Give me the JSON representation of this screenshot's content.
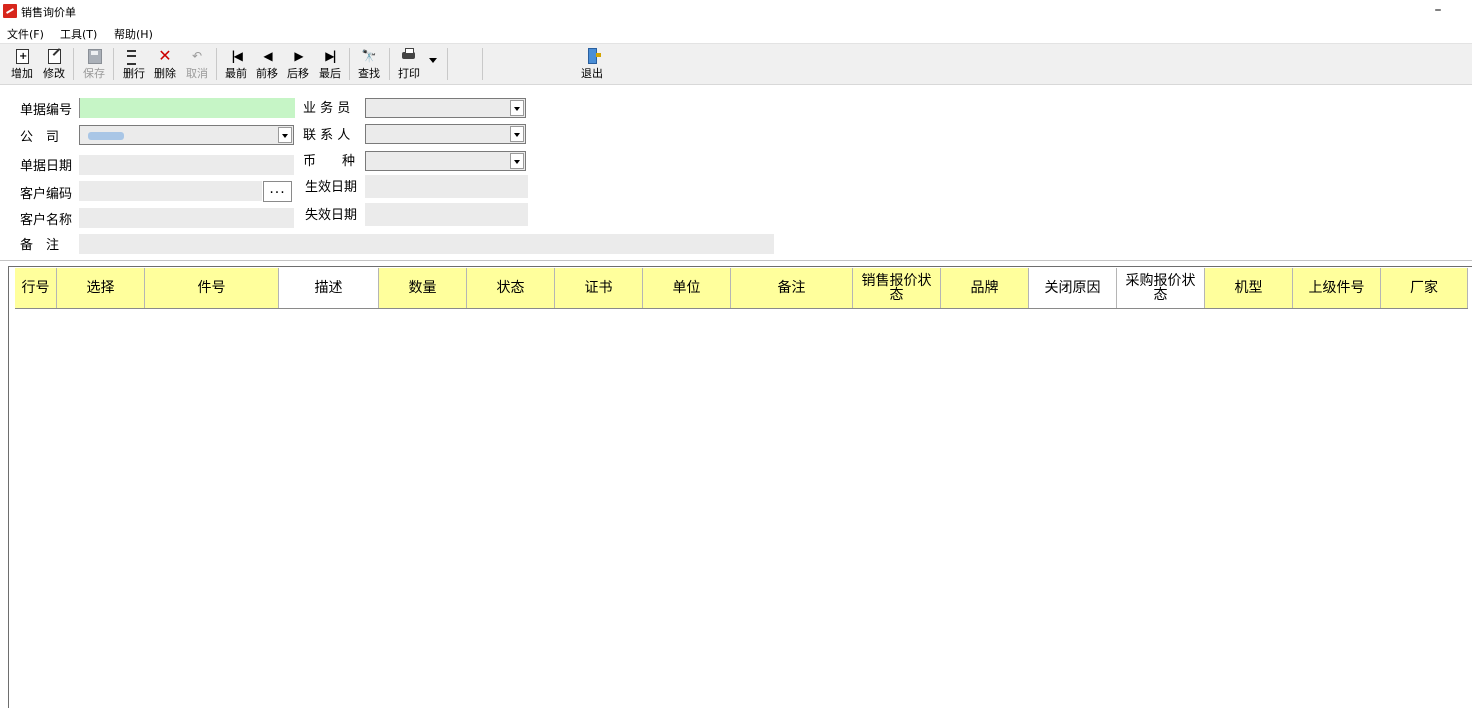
{
  "window": {
    "title": "销售询价单",
    "minimize_glyph": "–"
  },
  "menu": [
    {
      "label": "文件(F)"
    },
    {
      "label": "工具(T)"
    },
    {
      "label": "帮助(H)"
    }
  ],
  "toolbar": {
    "add": "增加",
    "edit": "修改",
    "save": "保存",
    "delete_row": "删行",
    "delete": "删除",
    "cancel": "取消",
    "first": "最前",
    "prev": "前移",
    "next": "后移",
    "last": "最后",
    "find": "查找",
    "print": "打印",
    "exit": "退出",
    "icons": {
      "add": "new-doc-icon",
      "edit": "edit-doc-icon",
      "save": "save-icon",
      "delete_row": "delete-row-icon",
      "delete": "red-x-icon",
      "cancel": "undo-icon",
      "first": "first-record-icon",
      "prev": "prev-record-icon",
      "next": "next-record-icon",
      "last": "last-record-icon",
      "find": "binoculars-icon",
      "print": "printer-icon",
      "exit": "exit-door-icon"
    },
    "glyphs": {
      "first": "|◀",
      "prev": "◀",
      "next": "▶",
      "last": "▶|",
      "find": "🔭",
      "delete": "✕",
      "cancel": "↶",
      "plus": "+"
    }
  },
  "form": {
    "doc_no_label": "单据编号",
    "doc_no_value": "",
    "company_label": "公　司",
    "company_value": "",
    "doc_date_label": "单据日期",
    "doc_date_value": "",
    "customer_code_label": "客户编码",
    "customer_code_value": "",
    "customer_code_button": "...",
    "customer_name_label": "客户名称",
    "customer_name_value": "",
    "remark_label": "备　注",
    "remark_value": "",
    "salesman_label": "业 务 员",
    "salesman_value": "",
    "contact_label": "联 系 人",
    "contact_value": "",
    "currency_label": "币　　种",
    "currency_value": "",
    "effective_date_label": "生效日期",
    "effective_date_value": "",
    "expire_date_label": "失效日期",
    "expire_date_value": ""
  },
  "colors": {
    "required_field": "#c6f5c6",
    "header_required": "#ffff9c",
    "field_bg": "#ebebeb"
  },
  "grid": {
    "columns": [
      {
        "label": "行号"
      },
      {
        "label": "选择"
      },
      {
        "label": "件号"
      },
      {
        "label": "描述"
      },
      {
        "label": "数量"
      },
      {
        "label": "状态"
      },
      {
        "label": "证书"
      },
      {
        "label": "单位"
      },
      {
        "label": "备注"
      },
      {
        "label": "销售报价状态"
      },
      {
        "label": "品牌"
      },
      {
        "label": "关闭原因"
      },
      {
        "label": "采购报价状态"
      },
      {
        "label": "机型"
      },
      {
        "label": "上级件号"
      },
      {
        "label": "厂家"
      }
    ],
    "rows": []
  }
}
